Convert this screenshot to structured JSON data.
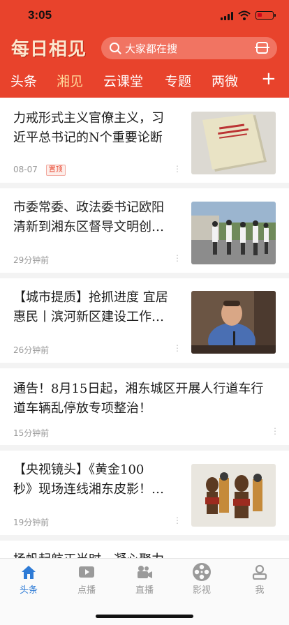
{
  "status_bar": {
    "time": "3:05"
  },
  "header": {
    "logo_text": "每日相见",
    "search_placeholder": "大家都在搜",
    "tabs": [
      {
        "label": "头条",
        "active": false
      },
      {
        "label": "湘见",
        "active": true
      },
      {
        "label": "云课堂",
        "active": false
      },
      {
        "label": "专题",
        "active": false
      },
      {
        "label": "两微",
        "active": false
      }
    ],
    "add_tab_label": "+"
  },
  "news": [
    {
      "title_line1": "力戒形式主义官僚主义，习",
      "title_line2": "近平总书记的N个重要论断",
      "meta": "08-07",
      "tag": "置顶",
      "more": "⋮",
      "thumb": "book-cover"
    },
    {
      "title_line1": "市委常委、政法委书记欧阳",
      "title_line2": "清新到湘东区督导文明创…",
      "meta": "29分钟前",
      "more": "⋮",
      "thumb": "officials-walking"
    },
    {
      "title_line1": "【城市提质】抢抓进度 宜居",
      "title_line2": "惠民丨滨河新区建设工作…",
      "meta": "26分钟前",
      "more": "⋮",
      "thumb": "meeting-speaker"
    },
    {
      "title_line1": "通告！8月15日起，湘东城区开展人行道车行",
      "title_line2": "道车辆乱停放专项整治！",
      "meta": "15分钟前",
      "more": "⋮"
    },
    {
      "title_line1": "【央视镜头】《黄金100",
      "title_line2": "秒》现场连线湘东皮影！…",
      "meta": "19分钟前",
      "more": "⋮",
      "thumb": "shadow-puppets"
    },
    {
      "title_line1": "扬帆起航正当时，凝心聚力"
    }
  ],
  "bottom_nav": [
    {
      "label": "头条",
      "icon": "home-icon",
      "active": true
    },
    {
      "label": "点播",
      "icon": "play-icon",
      "active": false
    },
    {
      "label": "直播",
      "icon": "camera-icon",
      "active": false
    },
    {
      "label": "影视",
      "icon": "film-reel-icon",
      "active": false
    },
    {
      "label": "我",
      "icon": "user-icon",
      "active": false
    }
  ],
  "colors": {
    "brand_red": "#e8432c",
    "tab_active": "#ffd79a",
    "nav_active": "#2e7bd6"
  }
}
